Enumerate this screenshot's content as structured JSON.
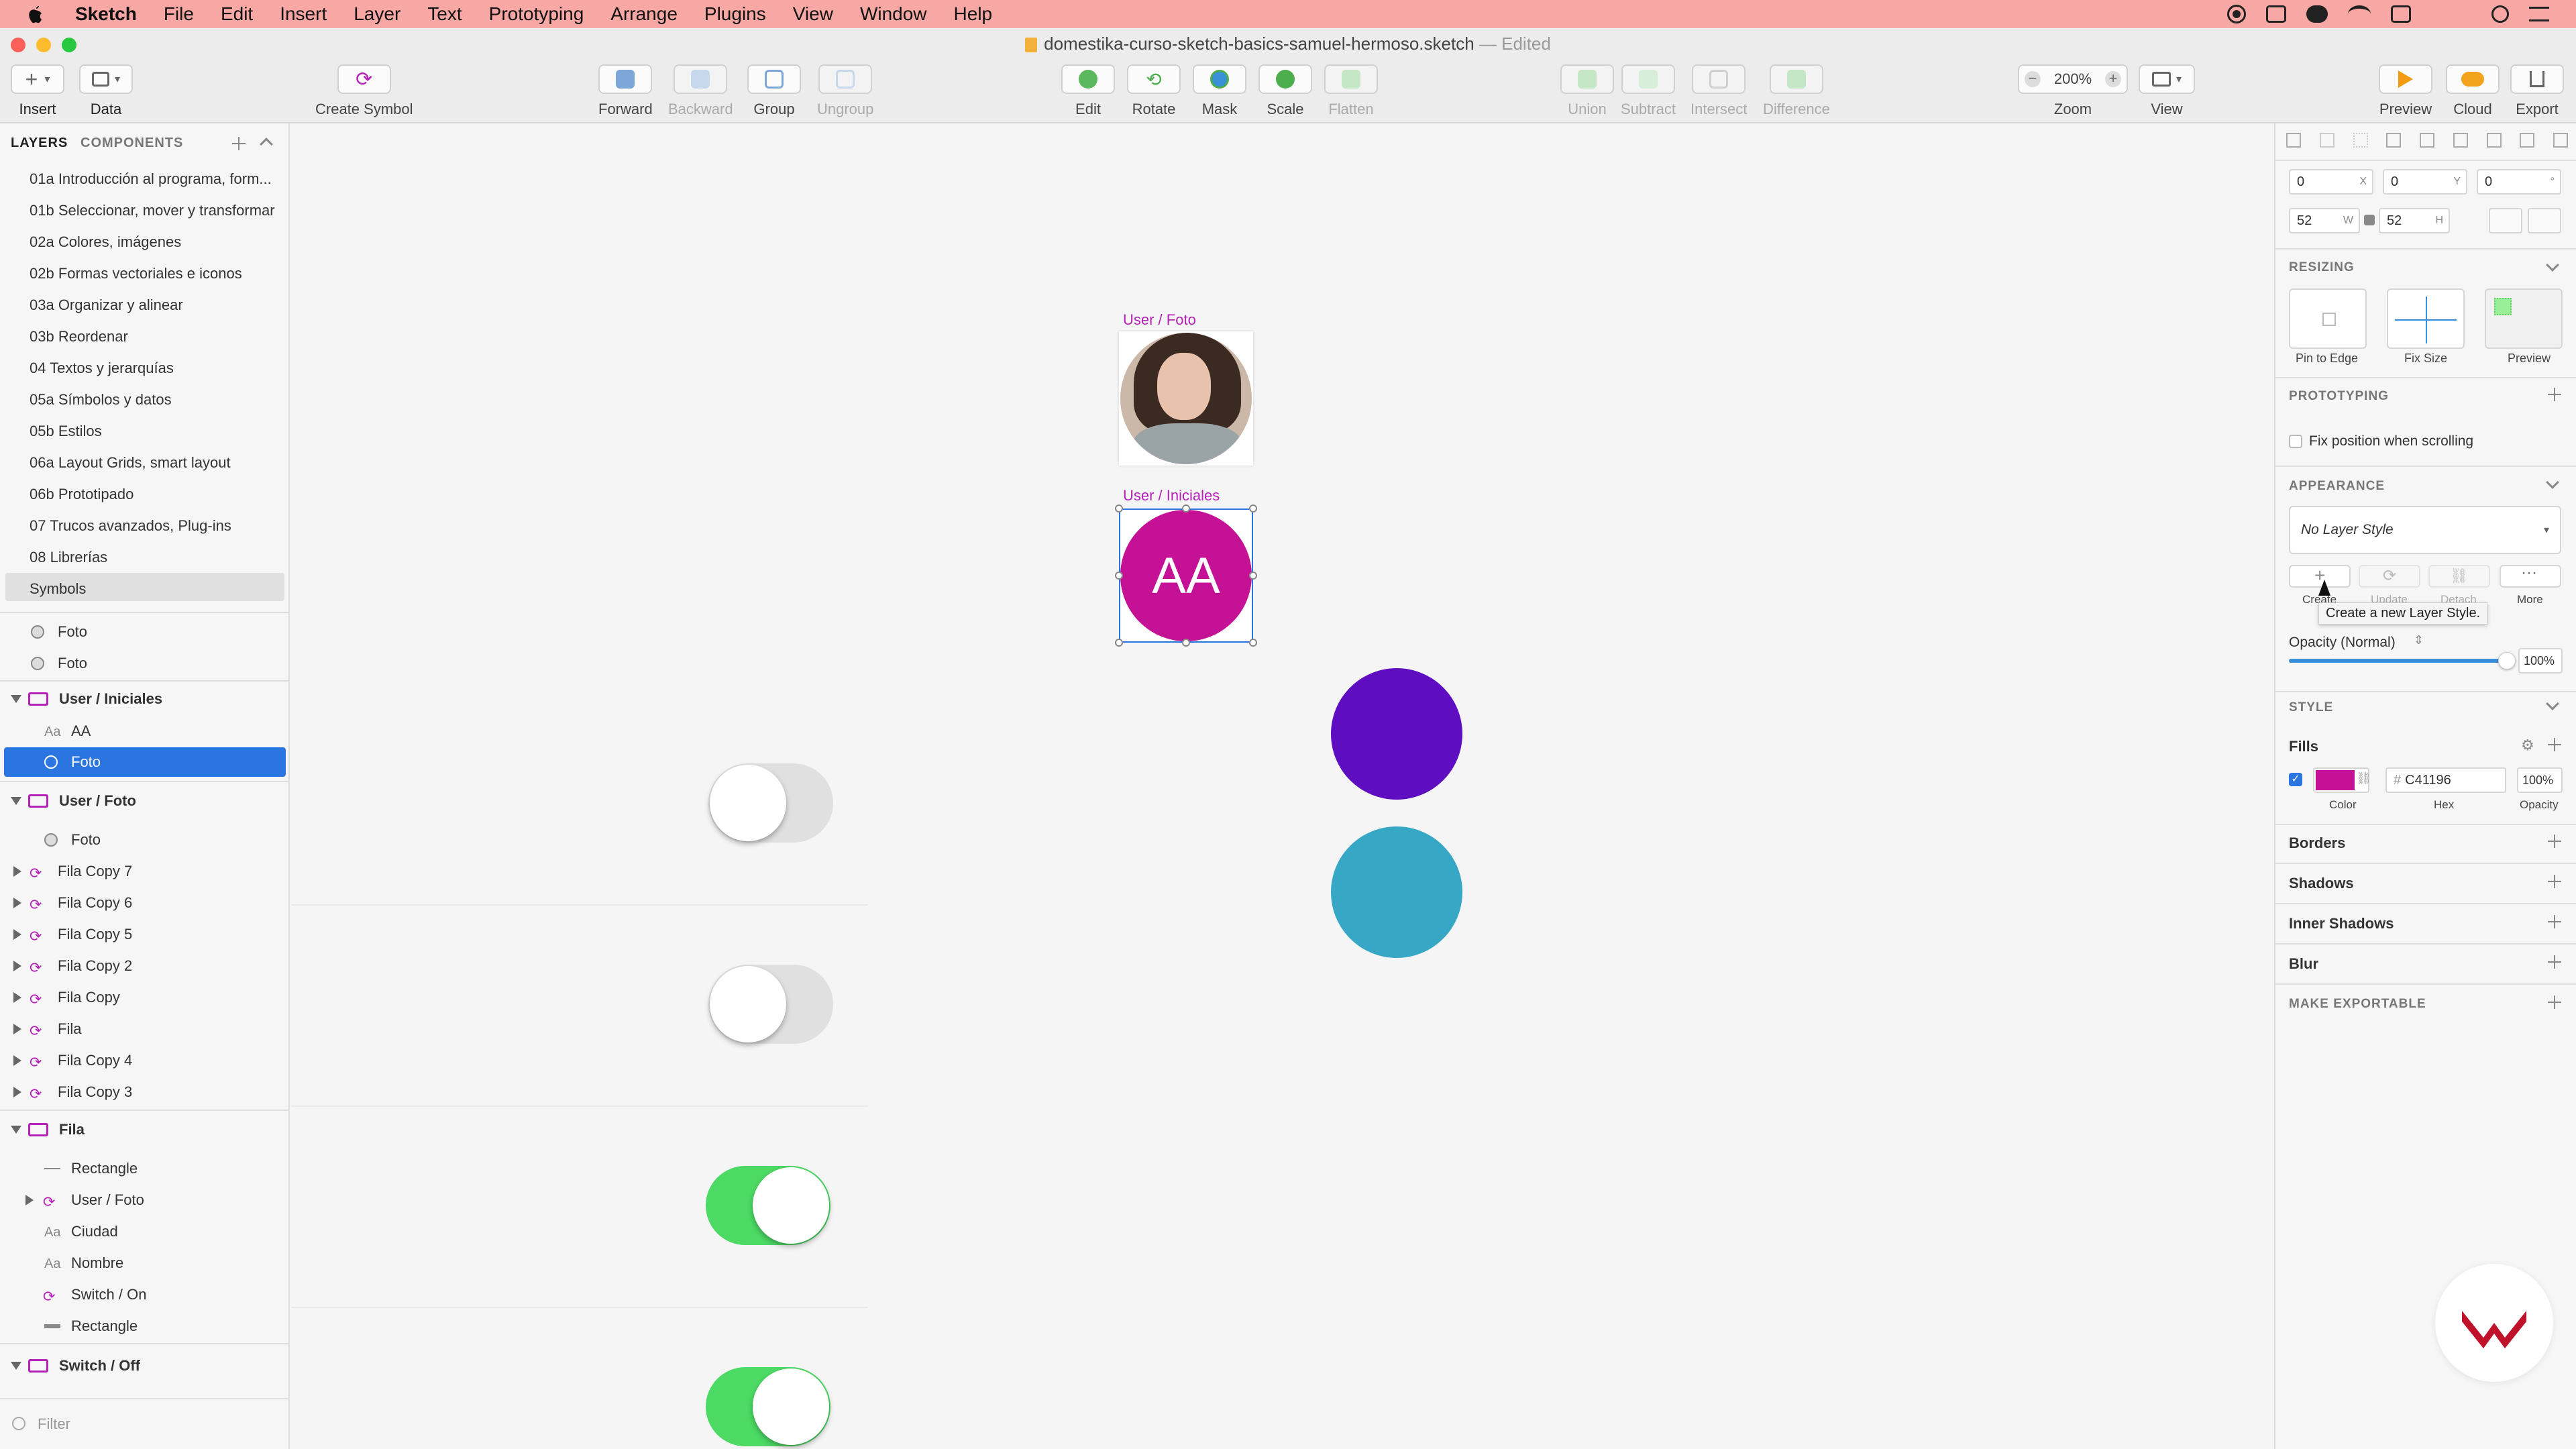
{
  "menubar": {
    "app": "Sketch",
    "items": [
      "File",
      "Edit",
      "Insert",
      "Layer",
      "Text",
      "Prototyping",
      "Arrange",
      "Plugins",
      "View",
      "Window",
      "Help"
    ]
  },
  "window": {
    "title": "domestika-curso-sketch-basics-samuel-hermoso.sketch",
    "status": "— Edited"
  },
  "toolbar": {
    "insert": "Insert",
    "data": "Data",
    "create_symbol": "Create Symbol",
    "forward": "Forward",
    "backward": "Backward",
    "group": "Group",
    "ungroup": "Ungroup",
    "edit": "Edit",
    "rotate": "Rotate",
    "mask": "Mask",
    "scale": "Scale",
    "flatten": "Flatten",
    "union": "Union",
    "subtract": "Subtract",
    "intersect": "Intersect",
    "difference": "Difference",
    "zoom_value": "200%",
    "zoom": "Zoom",
    "view": "View",
    "preview": "Preview",
    "cloud": "Cloud",
    "export": "Export"
  },
  "left": {
    "tab_layers": "LAYERS",
    "tab_components": "COMPONENTS",
    "pages": [
      "01a Introducción al programa, form...",
      "01b Seleccionar, mover y transformar",
      "02a Colores, imágenes",
      "02b Formas vectoriales e iconos",
      "03a Organizar y alinear",
      "03b Reordenar",
      "04 Textos y jerarquías",
      "05a Símbolos y datos",
      "05b Estilos",
      "06a Layout Grids, smart layout",
      "06b Prototipado",
      "07 Trucos avanzados, Plug-ins",
      "08 Librerías",
      "Symbols"
    ],
    "layers": [
      "Foto",
      "Foto",
      "User / Iniciales",
      "AA",
      "Foto",
      "User / Foto",
      "Foto",
      "Fila Copy 7",
      "Fila Copy 6",
      "Fila Copy 5",
      "Fila Copy 2",
      "Fila Copy",
      "Fila",
      "Fila Copy 4",
      "Fila Copy 3",
      "Fila",
      "Rectangle",
      "User / Foto",
      "Ciudad",
      "Nombre",
      "Switch / On",
      "Rectangle",
      "Switch / Off"
    ],
    "filter_placeholder": "Filter"
  },
  "canvas": {
    "label_foto": "User / Foto",
    "label_iniciales": "User / Iniciales",
    "initials": "AA",
    "colors": {
      "magenta": "#C41196",
      "purple": "#5E0EC0",
      "teal": "#36A7C5",
      "green": "#4CD964"
    }
  },
  "inspector": {
    "x": "0",
    "x_suf": "X",
    "y": "0",
    "y_suf": "Y",
    "rot": "0",
    "rot_suf": "°",
    "w": "52",
    "w_suf": "W",
    "h": "52",
    "h_suf": "H",
    "resizing": "RESIZING",
    "pin_to_edge": "Pin to Edge",
    "fix_size": "Fix Size",
    "preview": "Preview",
    "prototyping": "PROTOTYPING",
    "fix_position": "Fix position when scrolling",
    "appearance": "APPEARANCE",
    "layer_style": "No Layer Style",
    "create": "Create",
    "update": "Update",
    "detach": "Detach",
    "more": "More",
    "tooltip": "Create a new Layer Style.",
    "opacity_label": "Opacity (Normal)",
    "opacity_value": "100%",
    "style": "STYLE",
    "fills": "Fills",
    "hex_prefix": "#",
    "hex": "C41196",
    "fill_opacity": "100%",
    "color_lbl": "Color",
    "hex_lbl": "Hex",
    "opacity_lbl": "Opacity",
    "borders": "Borders",
    "shadows": "Shadows",
    "inner_shadows": "Inner Shadows",
    "blur": "Blur",
    "make_exportable": "MAKE EXPORTABLE"
  }
}
